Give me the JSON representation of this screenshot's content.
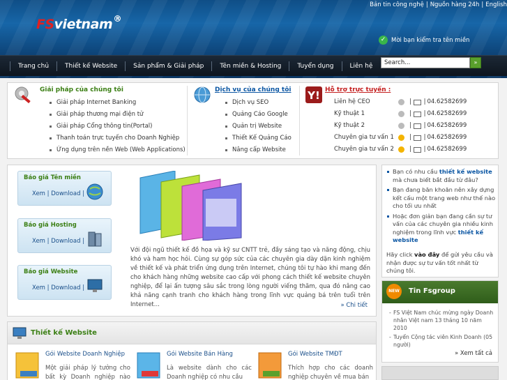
{
  "header": {
    "logo_fs": "FS",
    "logo_rest": "vietnam",
    "logo_reg": "R",
    "top_links": [
      "Bản tin công nghệ",
      "Nguồn hàng 24h",
      "English"
    ],
    "separator": "|",
    "domain_check": "Mời bạn kiểm tra tên miền"
  },
  "nav": {
    "items": [
      "Trang chủ",
      "Thiết kế Website",
      "Sản phẩm & Giải pháp",
      "Tên miền & Hosting",
      "Tuyển dụng",
      "Liên hệ"
    ],
    "search_value": "Search...",
    "search_go": "»"
  },
  "solutions": {
    "title": "Giải pháp của chúng tôi",
    "items": [
      "Giải pháp Internet Banking",
      "Giải pháp thương mại điện tử",
      "Giải pháp Cổng thông tin(Portal)",
      "Thanh toán trực tuyến cho Doanh Nghiệp",
      "Ứng dụng trên nền Web (Web Applications)"
    ]
  },
  "services": {
    "title": "Dịch vụ của chúng tôi",
    "items": [
      "Dịch vụ SEO",
      "Quảng Cáo Google",
      "Quản trị Website",
      "Thiết Kế Quảng Cáo",
      "Nâng cấp Website"
    ]
  },
  "support": {
    "title": "Hỗ trợ trực tuyến :",
    "rows": [
      {
        "name": "Liên hệ CEO",
        "phone": "04.62582699",
        "online": false
      },
      {
        "name": "Kỹ thuật 1",
        "phone": "04.62582699",
        "online": false
      },
      {
        "name": "Kỹ thuật 2",
        "phone": "04.62582699",
        "online": false
      },
      {
        "name": "Chuyên gia tư vấn 1",
        "phone": "04.62582699",
        "online": true
      },
      {
        "name": "Chuyên gia tư vấn 2",
        "phone": "04.62582699",
        "online": true
      }
    ],
    "sep": "|"
  },
  "quotes": [
    {
      "title": "Báo giá Tên miền",
      "view": "Xem",
      "download": "Download"
    },
    {
      "title": "Báo giá Hosting",
      "view": "Xem",
      "download": "Download"
    },
    {
      "title": "Báo giá Website",
      "view": "Xem",
      "download": "Download"
    }
  ],
  "quote_sep": "|",
  "intro": {
    "text": "Với đội ngũ thiết kế đồ họa và kỹ sư CNTT trẻ, đầy sáng tạo và năng động, chịu khó và ham học hỏi. Cùng sự góp sức của các chuyên gia dày dặn kinh nghiệm về thiết kế và phát triển ứng dụng trên Internet, chúng tôi tự hào khi mang đến cho khách hàng những website cao cấp với phong cách thiết kế website chuyên nghiệp, để lại ấn tượng sâu sắc trong lòng người viếng thăm, qua đó nâng cao khả năng cạnh tranh cho khách hàng trong lĩnh vực quảng bá trên tuổi trên Internet...",
    "more": "» Chi tiết"
  },
  "web_design": {
    "title": "Thiết kế Website",
    "packages": [
      {
        "title": "Gói Website Doanh Nghiệp",
        "desc": "Một giải pháp lý tưởng cho bất kỳ Doanh nghiệp nào cần"
      },
      {
        "title": "Gói Website Bán Hàng",
        "desc": "Là website dành cho các Doanh nghiệp có nhu cầu"
      },
      {
        "title": "Gói Website TMĐT",
        "desc": "Thích hợp cho các doanh nghiệp chuyên về mua bán"
      }
    ]
  },
  "sidebar": {
    "q1_pre": "Bạn có nhu cầu ",
    "q1_bold": "thiết kế website",
    "q1_post": " mà chưa biết bắt đầu từ đâu?",
    "q2": "Bạn đang băn khoăn nên xây dựng kết cấu một trang web như thế nào cho tối ưu nhất",
    "q3_pre": "Hoặc đơn giản bạn đang cần sự tư vấn của các chuyên gia nhiều kinh nghiệm trong lĩnh vực ",
    "q3_bold": "thiết kế website",
    "cta_pre": "Hãy click ",
    "cta_bold": "vào đây",
    "cta_post": " để gửi yêu cầu và nhận được sự tư vấn tốt nhất từ chúng tôi."
  },
  "news": {
    "badge": "NEW",
    "title": "Tin Fsgroup",
    "items": [
      "FS Việt Nam chúc mừng ngày Doanh nhân Việt nam 13 tháng 10 năm 2010",
      "Tuyển Cộng tác viên Kinh Doanh (05 người)"
    ],
    "all": "» Xem tất cả"
  },
  "colors": {
    "brand_red": "#e02020",
    "accent_green": "#3b7f14",
    "link_blue": "#0b56a3",
    "nav_dark": "#0e151e"
  },
  "icons": [
    "gear-tools-icon",
    "globe-service-icon",
    "yahoo-messenger-icon",
    "status-face-icon",
    "mail-icon",
    "globe-download-icon",
    "server-icon",
    "monitor-icon",
    "news-badge-icon"
  ]
}
